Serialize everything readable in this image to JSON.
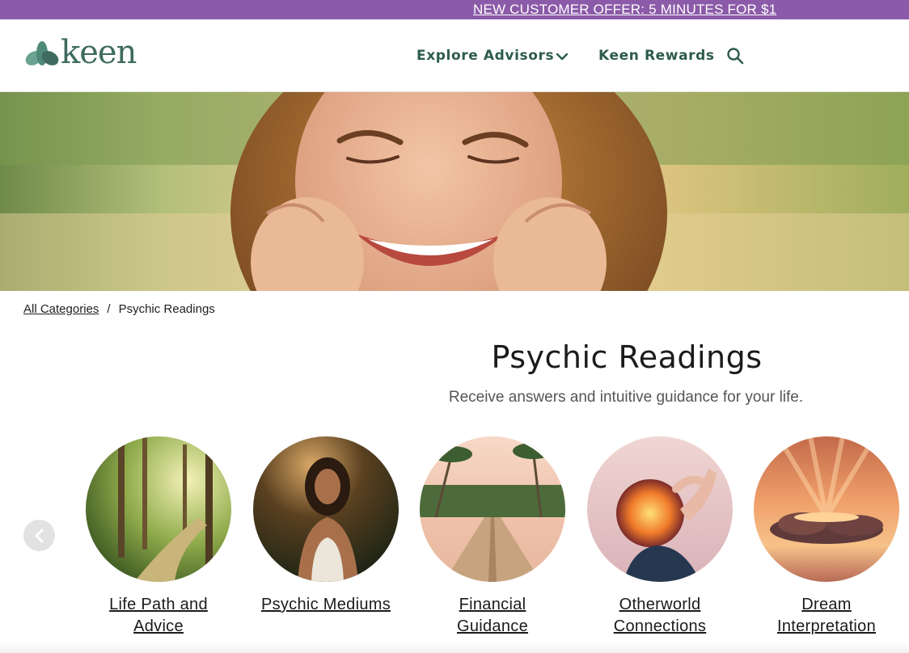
{
  "promo": {
    "text": "NEW CUSTOMER OFFER: 5 MINUTES FOR $1"
  },
  "header": {
    "logo_text": "keen",
    "nav": {
      "explore": "Explore Advisors",
      "rewards": "Keen Rewards"
    },
    "icons": {
      "chevron": "chevron-down-icon",
      "search": "search-icon"
    }
  },
  "hero": {
    "image": "smiling-woman-photo"
  },
  "breadcrumb": {
    "root": "All Categories",
    "separator": "/",
    "current": "Psychic Readings"
  },
  "page": {
    "title": "Psychic Readings",
    "subtitle": "Receive answers and intuitive guidance for your life."
  },
  "carousel": {
    "prev_icon": "chevron-left-icon",
    "categories": [
      {
        "line1": "Life Path and",
        "line2": "Advice",
        "image": "forest-path"
      },
      {
        "line1": "Psychic Mediums",
        "line2": "",
        "image": "meditating-woman"
      },
      {
        "line1": "Financial",
        "line2": "Guidance",
        "image": "palm-boardwalk"
      },
      {
        "line1": "Otherworld",
        "line2": "Connections",
        "image": "sun-silhouette"
      },
      {
        "line1": "Dream",
        "line2": "Interpretation",
        "image": "sunset-clouds"
      }
    ]
  },
  "colors": {
    "promo_bg": "#8b5aa8",
    "nav_text": "#2d5b4d",
    "logo": "#3f6b5f"
  }
}
